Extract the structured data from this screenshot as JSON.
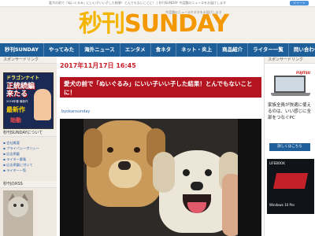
{
  "top": {
    "ticker": "愛犬の前で「ぬいぐるみ」にいい子いい子した結果！とんでもないことに！ | 秒刊SUNDAY 今話題のニュースをお届けします",
    "share_label": "ツイート"
  },
  "header": {
    "logo_jp": "秒刊",
    "logo_en": "SUNDAY",
    "tagline": "今話題のニュースやネタをお届けします"
  },
  "nav": {
    "items": [
      "秒刊SUNDAY",
      "やってみた",
      "海外ニュース",
      "エンタメ",
      "食ネタ",
      "ネット・炎上",
      "商品紹介",
      "ライター一覧",
      "問い合わせ"
    ]
  },
  "left": {
    "sponsored_head": "スポンサードリンク",
    "ad": {
      "line1": "ドラゴンナイト",
      "line2": "正統続編 来たる",
      "line3": "2018年春 最新作",
      "line4": "最新作",
      "line5": "始動"
    },
    "about_head": "秒刊SUNDAYについて",
    "about_items": [
      "会社概要",
      "プライバシーポリシー",
      "広告掲載",
      "ライター募集",
      "広告掲載に付いて",
      "ライター一覧"
    ],
    "rss_head": "秒刊のRSS"
  },
  "article": {
    "date": "2017年11月17日 16:45",
    "title": "愛犬の前で「ぬいぐるみ」にいい子いい子した結果！とんでもないことに！",
    "author": "byokansunday"
  },
  "right": {
    "sponsored_head": "スポンサードリンク",
    "brand": "FUJITSU",
    "ad_text": "家族全員が快適に使えるのは、いい感じに全部をつなぐPC",
    "ad_button": "詳しくはこちら",
    "ad2_label": "LIFEBOOK",
    "ad2_os": "Windows 10 Pro"
  },
  "colors": {
    "nav": "#1f5f99",
    "accent_red": "#b3141f",
    "logo_orange": "#f39800",
    "link": "#3366aa"
  }
}
